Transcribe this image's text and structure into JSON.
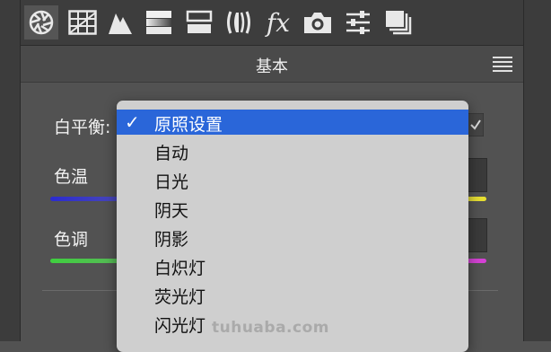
{
  "toolbar": {
    "tools": [
      {
        "name": "aperture-icon"
      },
      {
        "name": "grid-icon"
      },
      {
        "name": "tone-curve-icon"
      },
      {
        "name": "hsl-gradient-icon"
      },
      {
        "name": "split-toning-icon"
      },
      {
        "name": "lens-icon"
      },
      {
        "name": "fx-icon",
        "glyph": "fx"
      },
      {
        "name": "camera-icon"
      },
      {
        "name": "sliders-icon"
      },
      {
        "name": "presets-icon"
      }
    ]
  },
  "panel": {
    "title": "基本"
  },
  "basic": {
    "white_balance_label": "白平衡:",
    "temperature_label": "色温",
    "tint_label": "色调"
  },
  "dropdown": {
    "selected_index": 0,
    "items": [
      {
        "label": "原照设置",
        "selected": true
      },
      {
        "label": "自动"
      },
      {
        "label": "日光"
      },
      {
        "label": "阴天"
      },
      {
        "label": "阴影"
      },
      {
        "label": "白炽灯"
      },
      {
        "label": "荧光灯"
      },
      {
        "label": "闪光灯"
      }
    ]
  },
  "watermark": "tuhuaba.com",
  "colors": {
    "selection": "#2a66d9",
    "temp_track_left": "#2b2bd0",
    "temp_track_right": "#e8e030",
    "tint_track_left": "#3fd03f",
    "tint_track_right": "#d63fd6"
  }
}
